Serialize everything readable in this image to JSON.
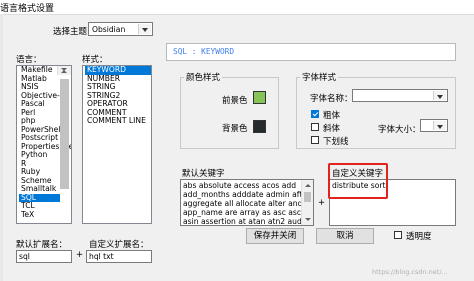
{
  "window": {
    "title": "语言格式设置"
  },
  "theme": {
    "label": "选择主题",
    "value": "Obsidian"
  },
  "language": {
    "label": "语言：",
    "items": [
      "Makefile",
      "Matlab",
      "NSIS",
      "Objective-C",
      "Pascal",
      "Perl",
      "php",
      "PowerShell",
      "Postscript",
      "Properties file",
      "Python",
      "R",
      "Ruby",
      "Scheme",
      "Smalltalk",
      "SQL",
      "TCL",
      "TeX"
    ],
    "selected_index": 15
  },
  "style": {
    "label": "样式：",
    "items": [
      "KEYWORD",
      "NUMBER",
      "STRING",
      "STRING2",
      "OPERATOR",
      "COMMENT",
      "COMMENT LINE"
    ],
    "selected_index": 0
  },
  "preview": {
    "text": "SQL : KEYWORD",
    "text_color": "#3f7ff0"
  },
  "color_style": {
    "label": "颜色样式",
    "fg_label": "前景色",
    "fg_color": "#86c45a",
    "bg_label": "背景色",
    "bg_color": "#252a2c"
  },
  "font_style": {
    "label": "字体样式",
    "name_label": "字体名称：",
    "name_value": "",
    "size_label": "字体大小：",
    "size_value": "",
    "bold_label": "粗体",
    "bold": true,
    "italic_label": "斜体",
    "italic": false,
    "underline_label": "下划线",
    "underline": false
  },
  "default_keywords": {
    "label": "默认关键字",
    "text": "abs absolute access acos add\nadd_months adddate admin after\naggregate all allocate alter and any\napp_name are array as asc ascii\nasin assertion at atan atn2 audit"
  },
  "plus_sign": "+",
  "custom_keywords": {
    "label": "自定义关键字",
    "text": "distribute sort",
    "highlight_color": "#e0241b"
  },
  "default_ext": {
    "label": "默认扩展名：",
    "value": "sql"
  },
  "custom_ext": {
    "label": "自定义扩展名：",
    "value": "hql txt"
  },
  "buttons": {
    "save_close": "保存并关闭",
    "cancel": "取消"
  },
  "transparency": {
    "label": "透明度",
    "checked": false
  },
  "watermark": "https://blog.csdn.net/..."
}
